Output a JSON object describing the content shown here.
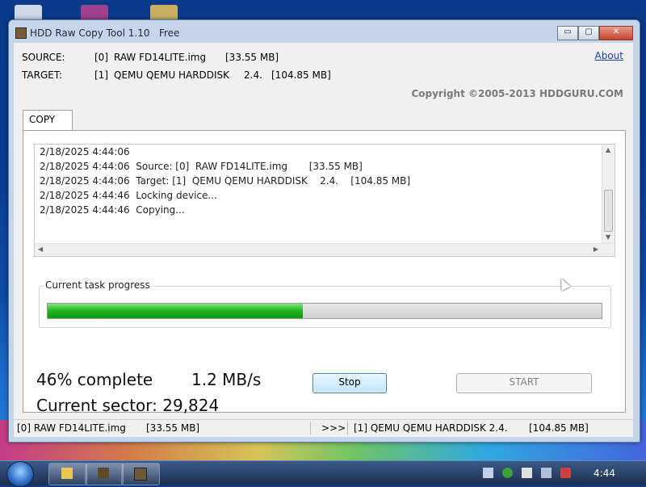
{
  "window": {
    "title": "HDD Raw Copy Tool 1.10",
    "edition": "Free",
    "buttons": {
      "minimize": "▭",
      "maximize": "▢",
      "close": "✕"
    }
  },
  "header": {
    "source_label": "SOURCE:",
    "source_index": "[0]",
    "source_name": "RAW FD14LITE.img",
    "source_size": "[33.55 MB]",
    "target_label": "TARGET:",
    "target_index": "[1]",
    "target_name": "QEMU QEMU HARDDISK",
    "target_rev": "2.4.",
    "target_size": "[104.85 MB]",
    "about_link": "About",
    "copyright": "Copyright ©2005-2013 HDDGURU.COM"
  },
  "tabs": [
    {
      "label": "COPY"
    }
  ],
  "log": [
    "2/18/2025 4:44:06",
    "2/18/2025 4:44:06  Source: [0]  RAW FD14LITE.img       [33.55 MB]",
    "2/18/2025 4:44:06  Target: [1]  QEMU QEMU HARDDISK    2.4.    [104.85 MB]",
    "2/18/2025 4:44:46  Locking device...",
    "2/18/2025 4:44:46  Copying..."
  ],
  "progress": {
    "group_label": "Current task progress",
    "fraction": 0.46
  },
  "status": {
    "percent_text": "46% complete",
    "speed": "1.2 MB/s",
    "sector_text": "Current sector: 29,824"
  },
  "buttons": {
    "stop": "Stop",
    "start": "START"
  },
  "statusbar": {
    "source": "[0]  RAW FD14LITE.img",
    "source_size": "[33.55 MB]",
    "arrow": ">>>",
    "target": "[1]  QEMU QEMU HARDDISK    2.4.",
    "target_size": "[104.85 MB]"
  },
  "taskbar": {
    "clock": "4:44"
  },
  "colors": {
    "progress_fill": "#1fb21f",
    "link": "#1a3ea8",
    "desktop": "#0b3a8a"
  }
}
